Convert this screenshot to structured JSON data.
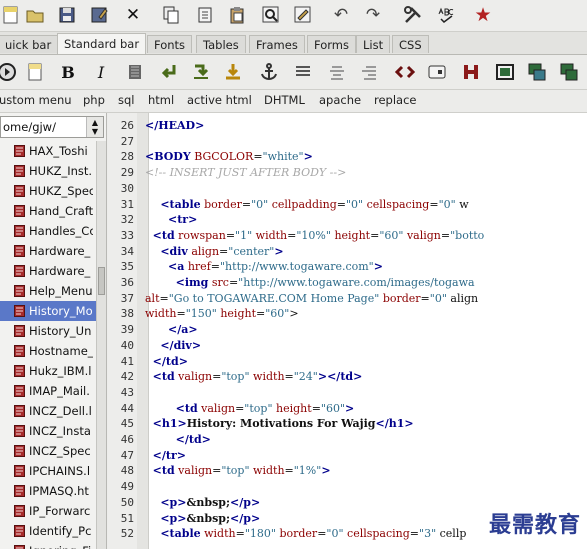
{
  "tabs": [
    {
      "label": "uick bar",
      "active": false
    },
    {
      "label": "Standard bar",
      "active": true
    },
    {
      "label": "Fonts",
      "active": false
    },
    {
      "label": "Tables",
      "active": false
    },
    {
      "label": "Frames",
      "active": false
    },
    {
      "label": "Forms",
      "active": false
    },
    {
      "label": "List",
      "active": false
    },
    {
      "label": "CSS",
      "active": false
    }
  ],
  "tag_toolbar_text": {
    "bold": "B",
    "italic": "I"
  },
  "menus": [
    "ustom menu",
    "php",
    "sql",
    "html",
    "active html",
    "DHTML",
    "apache",
    "replace"
  ],
  "file_panel": {
    "path": "ome/gjw/",
    "files": [
      {
        "name": "HAX_Toshi",
        "selected": false
      },
      {
        "name": "HUKZ_Inst.",
        "selected": false
      },
      {
        "name": "HUKZ_Spec",
        "selected": false
      },
      {
        "name": "Hand_Craft",
        "selected": false
      },
      {
        "name": "Handles_Cc",
        "selected": false
      },
      {
        "name": "Hardware_",
        "selected": false
      },
      {
        "name": "Hardware_",
        "selected": false
      },
      {
        "name": "Help_Menu",
        "selected": false
      },
      {
        "name": "History_Mo",
        "selected": true
      },
      {
        "name": "History_Un",
        "selected": false
      },
      {
        "name": "Hostname_",
        "selected": false
      },
      {
        "name": "Hukz_IBM.l",
        "selected": false
      },
      {
        "name": "IMAP_Mail.",
        "selected": false
      },
      {
        "name": "INCZ_Dell.l",
        "selected": false
      },
      {
        "name": "INCZ_Insta",
        "selected": false
      },
      {
        "name": "INCZ_Spec",
        "selected": false
      },
      {
        "name": "IPCHAINS.l",
        "selected": false
      },
      {
        "name": "IPMASQ.ht",
        "selected": false
      },
      {
        "name": "IP_Forwarc",
        "selected": false
      },
      {
        "name": "Identify_Pc",
        "selected": false
      },
      {
        "name": "Ignoring_Fi",
        "selected": false
      }
    ]
  },
  "editor": {
    "line_numbers": [
      "26",
      "27",
      "28",
      "29",
      "30",
      "31",
      "32",
      "33",
      "34",
      "35",
      "36",
      "37",
      "38",
      "39",
      "40",
      "41",
      "42",
      "43",
      "44",
      "45",
      "46",
      "47",
      "48",
      "49",
      "50",
      "51",
      "52"
    ],
    "lines": [
      "</HEAD>",
      "",
      "<BODY BGCOLOR=\"white\">",
      "<!-- INSERT JUST AFTER BODY -->",
      "",
      "    <table border=\"0\" cellpadding=\"0\" cellspacing=\"0\" w",
      "      <tr>",
      "  <td rowspan=\"1\" width=\"10%\" height=\"60\" valign=\"botto",
      "    <div align=\"center\">",
      "      <a href=\"http://www.togaware.com\">",
      "        <img src=\"http://www.togaware.com/images/togawa",
      "alt=\"Go to TOGAWARE.COM Home Page\" border=\"0\" align",
      "width=\"150\" height=\"60\">",
      "      </a>",
      "    </div>",
      "  </td>",
      "  <td valign=\"top\" width=\"24\"></td>",
      "",
      "        <td valign=\"top\" height=\"60\">",
      "  <h1>History: Motivations For Wajig</h1>",
      "        </td>",
      "  </tr>",
      "  <td valign=\"top\" width=\"1%\">",
      "",
      "    <p>&nbsp;</p>",
      "    <p>&nbsp;</p>",
      "    <table width=\"180\" border=\"0\" cellspacing=\"3\" cellp"
    ]
  },
  "watermark": "最需教育",
  "colors": {
    "tag": "#00008b",
    "attr_name": "#8b0000",
    "attr_value": "#2e6b8a",
    "comment": "#a8a8a8",
    "selection": "#5a78c8"
  }
}
